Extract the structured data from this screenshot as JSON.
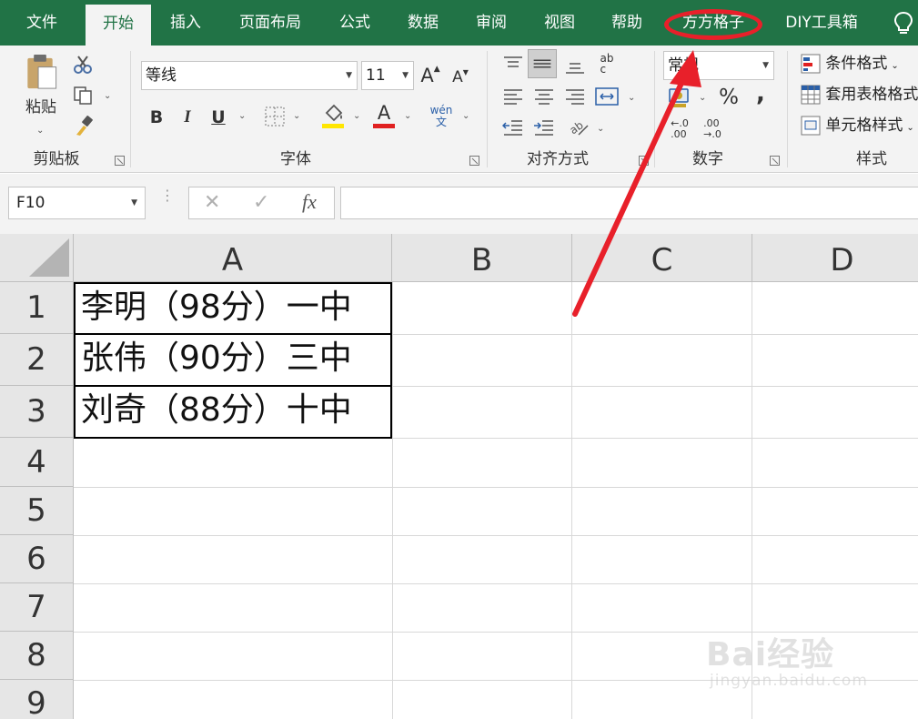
{
  "colors": {
    "brand": "#217346",
    "annotation": "#e8202a",
    "font_color_bar": "#e02020",
    "fill_color_bar": "#ffe600"
  },
  "ribbon_tabs": [
    {
      "label": "文件"
    },
    {
      "label": "开始",
      "active": true
    },
    {
      "label": "插入"
    },
    {
      "label": "页面布局"
    },
    {
      "label": "公式"
    },
    {
      "label": "数据"
    },
    {
      "label": "审阅"
    },
    {
      "label": "视图"
    },
    {
      "label": "帮助"
    },
    {
      "label": "方方格子",
      "highlighted": true
    },
    {
      "label": "DIY工具箱"
    }
  ],
  "clipboard": {
    "paste_label": "粘贴",
    "group_label": "剪贴板"
  },
  "font": {
    "name": "等线",
    "size": "11",
    "group_label": "字体",
    "bold": "B",
    "italic": "I",
    "underline": "U",
    "font_color_glyph": "A",
    "phonetic_glyph": "wén\n文",
    "grow_glyph": "A",
    "shrink_glyph": "A"
  },
  "alignment": {
    "group_label": "对齐方式",
    "wrap_glyph": "ab\nc"
  },
  "number": {
    "format": "常规",
    "group_label": "数字",
    "percent": "%",
    "comma": ",",
    "inc_decimal": "←.0\n.00",
    "dec_decimal": ".00\n→.0"
  },
  "styles": {
    "conditional": "条件格式",
    "table_format": "套用表格格式",
    "cell_styles": "单元格样式",
    "group_label": "样式"
  },
  "formula_bar": {
    "name_box": "F10",
    "cancel": "✕",
    "enter": "✓",
    "fx": "fx",
    "value": ""
  },
  "sheet": {
    "columns": [
      "A",
      "B",
      "C",
      "D"
    ],
    "rows": [
      "1",
      "2",
      "3",
      "4",
      "5",
      "6",
      "7",
      "8",
      "9"
    ],
    "cells": {
      "A1": "李明（98分）一中",
      "A2": "张伟（90分）三中",
      "A3": "刘奇（88分）十中"
    }
  },
  "watermark": {
    "brand": "Bai经验",
    "url": "jingyan.baidu.com"
  }
}
